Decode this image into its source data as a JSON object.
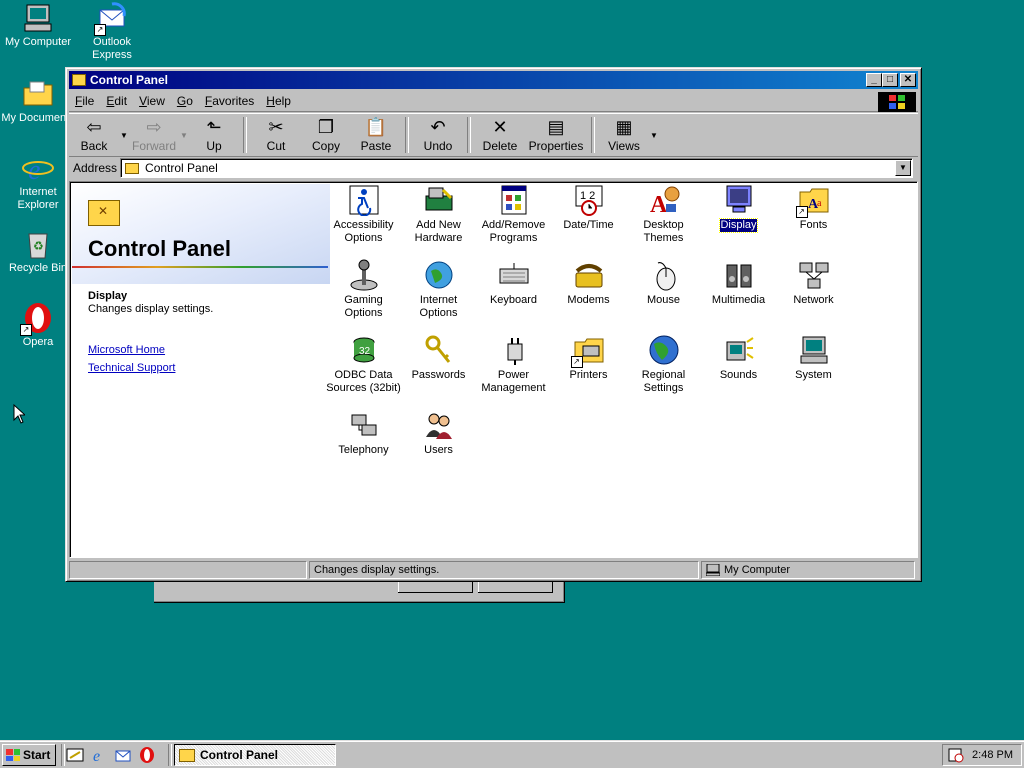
{
  "desktop": {
    "icons": [
      {
        "label": "My Computer"
      },
      {
        "label": "Outlook Express"
      },
      {
        "label": "My Documents"
      },
      {
        "label": "Internet Explorer"
      },
      {
        "label": "Recycle Bin"
      },
      {
        "label": "Opera"
      }
    ]
  },
  "window": {
    "title": "Control Panel",
    "menu": [
      "File",
      "Edit",
      "View",
      "Go",
      "Favorites",
      "Help"
    ],
    "toolbar": {
      "back": "Back",
      "forward": "Forward",
      "up": "Up",
      "cut": "Cut",
      "copy": "Copy",
      "paste": "Paste",
      "undo": "Undo",
      "delete": "Delete",
      "properties": "Properties",
      "views": "Views"
    },
    "address": {
      "label": "Address",
      "value": "Control Panel"
    },
    "left_pane": {
      "title": "Control Panel",
      "selected_name": "Display",
      "selected_desc": "Changes display settings.",
      "links": [
        "Microsoft Home",
        "Technical Support"
      ]
    },
    "items": [
      "Accessibility Options",
      "Add New Hardware",
      "Add/Remove Programs",
      "Date/Time",
      "Desktop Themes",
      "Display",
      "Fonts",
      "Gaming Options",
      "Internet Options",
      "Keyboard",
      "Modems",
      "Mouse",
      "Multimedia",
      "Network",
      "ODBC Data Sources (32bit)",
      "Passwords",
      "Power Management",
      "Printers",
      "Regional Settings",
      "Sounds",
      "System",
      "Telephony",
      "Users"
    ],
    "selected_item": "Display",
    "status": {
      "left": "",
      "middle": "Changes display settings.",
      "right": "My Computer"
    }
  },
  "taskbar": {
    "start": "Start",
    "task": "Control Panel",
    "clock": "2:48 PM"
  },
  "colors": {
    "desktop": "#008080",
    "title_start": "#000080",
    "title_end": "#1084d0",
    "face": "#c0c0c0"
  }
}
